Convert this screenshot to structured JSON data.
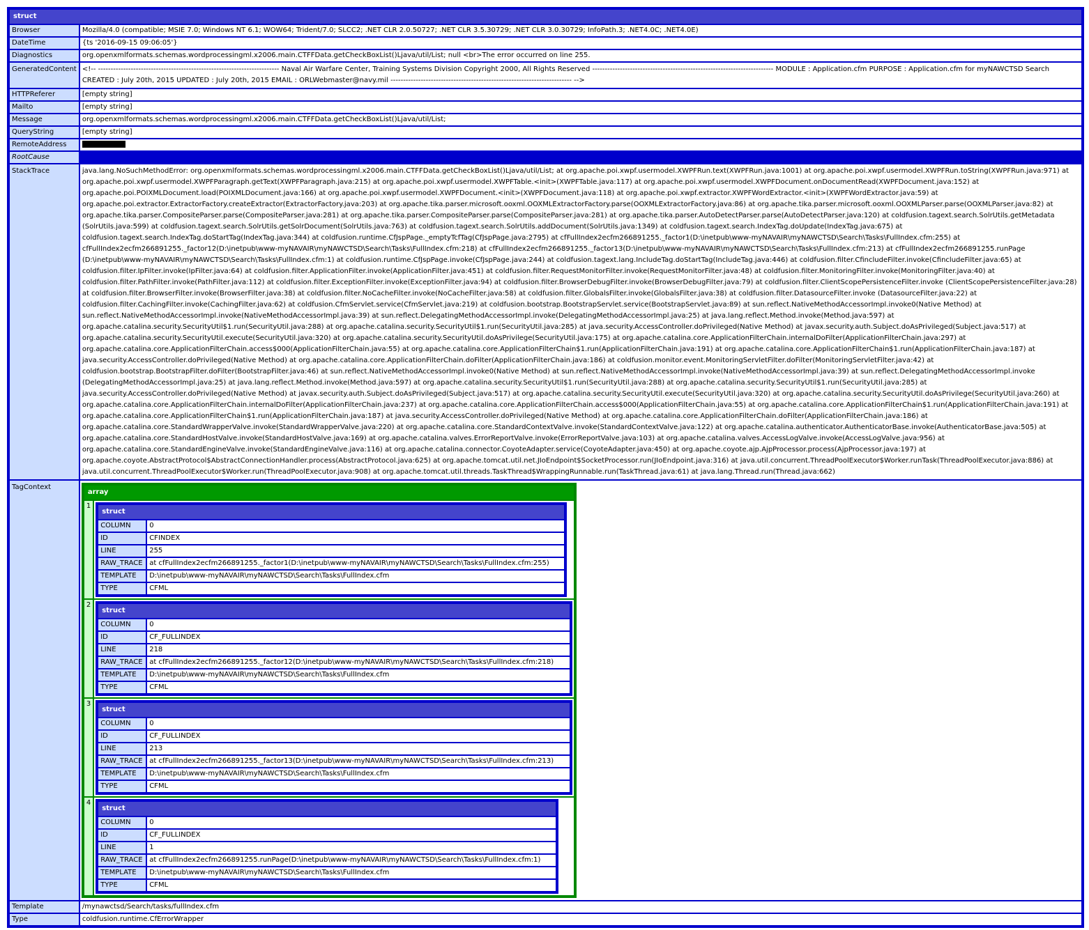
{
  "root": {
    "header": "struct",
    "rows": {
      "browser": {
        "key": "Browser",
        "value": "Mozilla/4.0 (compatible; MSIE 7.0; Windows NT 6.1; WOW64; Trident/7.0; SLCC2; .NET CLR 2.0.50727; .NET CLR 3.5.30729; .NET CLR 3.0.30729; InfoPath.3; .NET4.0C; .NET4.0E)"
      },
      "datetime": {
        "key": "DateTime",
        "value": "{ts '2016-09-15 09:06:05'}"
      },
      "diagnostics": {
        "key": "Diagnostics",
        "value": "org.openxmlformats.schemas.wordprocessingml.x2006.main.CTFFData.getCheckBoxList()Ljava/util/List; null <br>The error occurred on line 255."
      },
      "generated": {
        "key": "GeneratedContent",
        "value": "<!-- ------------------------------------------------------------------------ Naval Air Warfare Center, Training Systems Division Copyright 2000, All Rights Reserved ------------------------------------------------------------------------ MODULE : Application.cfm PURPOSE : Application.cfm for myNAWCTSD Search CREATED : July 20th, 2015 UPDATED : July 20th, 2015 EMAIL : ORLWebmaster@navy.mil ------------------------------------------------------------------------ -->"
      },
      "httpreferer": {
        "key": "HTTPReferer",
        "value": "[empty string]"
      },
      "mailto": {
        "key": "Mailto",
        "value": "[empty string]"
      },
      "message": {
        "key": "Message",
        "value": "org.openxmlformats.schemas.wordprocessingml.x2006.main.CTFFData.getCheckBoxList()Ljava/util/List;"
      },
      "querystring": {
        "key": "QueryString",
        "value": "[empty string]"
      },
      "remoteaddress": {
        "key": "RemoteAddress",
        "value": ""
      },
      "rootcause": {
        "key": "RootCause",
        "value": ""
      },
      "stacktrace": {
        "key": "StackTrace",
        "value": "java.lang.NoSuchMethodError: org.openxmlformats.schemas.wordprocessingml.x2006.main.CTFFData.getCheckBoxList()Ljava/util/List; at org.apache.poi.xwpf.usermodel.XWPFRun.text(XWPFRun.java:1001) at org.apache.poi.xwpf.usermodel.XWPFRun.toString(XWPFRun.java:971) at org.apache.poi.xwpf.usermodel.XWPFParagraph.getText(XWPFParagraph.java:215) at org.apache.poi.xwpf.usermodel.XWPFTable.<init>(XWPFTable.java:117) at org.apache.poi.xwpf.usermodel.XWPFDocument.onDocumentRead(XWPFDocument.java:152) at org.apache.poi.POIXMLDocument.load(POIXMLDocument.java:166) at org.apache.poi.xwpf.usermodel.XWPFDocument.<init>(XWPFDocument.java:118) at org.apache.poi.xwpf.extractor.XWPFWordExtractor.<init>(XWPFWordExtractor.java:59) at org.apache.poi.extractor.ExtractorFactory.createExtractor(ExtractorFactory.java:203) at org.apache.tika.parser.microsoft.ooxml.OOXMLExtractorFactory.parse(OOXMLExtractorFactory.java:86) at org.apache.tika.parser.microsoft.ooxml.OOXMLParser.parse(OOXMLParser.java:82) at org.apache.tika.parser.CompositeParser.parse(CompositeParser.java:281) at org.apache.tika.parser.CompositeParser.parse(CompositeParser.java:281) at org.apache.tika.parser.AutoDetectParser.parse(AutoDetectParser.java:120) at coldfusion.tagext.search.SolrUtils.getMetadata (SolrUtils.java:599) at coldfusion.tagext.search.SolrUtils.getSolrDocument(SolrUtils.java:763) at coldfusion.tagext.search.SolrUtils.addDocument(SolrUtils.java:1349) at coldfusion.tagext.search.IndexTag.doUpdate(IndexTag.java:675) at coldfusion.tagext.search.IndexTag.doStartTag(IndexTag.java:344) at coldfusion.runtime.CfJspPage._emptyTcfTag(CfJspPage.java:2795) at cfFullIndex2ecfm266891255._factor1(D:\\inetpub\\www-myNAVAIR\\myNAWCTSD\\Search\\Tasks\\FullIndex.cfm:255) at cfFullIndex2ecfm266891255._factor12(D:\\inetpub\\www-myNAVAIR\\myNAWCTSD\\Search\\Tasks\\FullIndex.cfm:218) at cfFullIndex2ecfm266891255._factor13(D:\\inetpub\\www-myNAVAIR\\myNAWCTSD\\Search\\Tasks\\FullIndex.cfm:213) at cfFullIndex2ecfm266891255.runPage (D:\\inetpub\\www-myNAVAIR\\myNAWCTSD\\Search\\Tasks\\FullIndex.cfm:1) at coldfusion.runtime.CfJspPage.invoke(CfJspPage.java:244) at coldfusion.tagext.lang.IncludeTag.doStartTag(IncludeTag.java:446) at coldfusion.filter.CfincludeFilter.invoke(CfincludeFilter.java:65) at coldfusion.filter.IpFilter.invoke(IpFilter.java:64) at coldfusion.filter.ApplicationFilter.invoke(ApplicationFilter.java:451) at coldfusion.filter.RequestMonitorFilter.invoke(RequestMonitorFilter.java:48) at coldfusion.filter.MonitoringFilter.invoke(MonitoringFilter.java:40) at coldfusion.filter.PathFilter.invoke(PathFilter.java:112) at coldfusion.filter.ExceptionFilter.invoke(ExceptionFilter.java:94) at coldfusion.filter.BrowserDebugFilter.invoke(BrowserDebugFilter.java:79) at coldfusion.filter.ClientScopePersistenceFilter.invoke (ClientScopePersistenceFilter.java:28) at coldfusion.filter.BrowserFilter.invoke(BrowserFilter.java:38) at coldfusion.filter.NoCacheFilter.invoke(NoCacheFilter.java:58) at coldfusion.filter.GlobalsFilter.invoke(GlobalsFilter.java:38) at coldfusion.filter.DatasourceFilter.invoke (DatasourceFilter.java:22) at coldfusion.filter.CachingFilter.invoke(CachingFilter.java:62) at coldfusion.CfmServlet.service(CfmServlet.java:219) at coldfusion.bootstrap.BootstrapServlet.service(BootstrapServlet.java:89) at sun.reflect.NativeMethodAccessorImpl.invoke0(Native Method) at sun.reflect.NativeMethodAccessorImpl.invoke(NativeMethodAccessorImpl.java:39) at sun.reflect.DelegatingMethodAccessorImpl.invoke(DelegatingMethodAccessorImpl.java:25) at java.lang.reflect.Method.invoke(Method.java:597) at org.apache.catalina.security.SecurityUtil$1.run(SecurityUtil.java:288) at org.apache.catalina.security.SecurityUtil$1.run(SecurityUtil.java:285) at java.security.AccessController.doPrivileged(Native Method) at javax.security.auth.Subject.doAsPrivileged(Subject.java:517) at org.apache.catalina.security.SecurityUtil.execute(SecurityUtil.java:320) at org.apache.catalina.security.SecurityUtil.doAsPrivilege(SecurityUtil.java:175) at org.apache.catalina.core.ApplicationFilterChain.internalDoFilter(ApplicationFilterChain.java:297) at org.apache.catalina.core.ApplicationFilterChain.access$000(ApplicationFilterChain.java:55) at org.apache.catalina.core.ApplicationFilterChain$1.run(ApplicationFilterChain.java:191) at org.apache.catalina.core.ApplicationFilterChain$1.run(ApplicationFilterChain.java:187) at java.security.AccessController.doPrivileged(Native Method) at org.apache.catalina.core.ApplicationFilterChain.doFilter(ApplicationFilterChain.java:186) at coldfusion.monitor.event.MonitoringServletFilter.doFilter(MonitoringServletFilter.java:42) at coldfusion.bootstrap.BootstrapFilter.doFilter(BootstrapFilter.java:46) at sun.reflect.NativeMethodAccessorImpl.invoke0(Native Method) at sun.reflect.NativeMethodAccessorImpl.invoke(NativeMethodAccessorImpl.java:39) at sun.reflect.DelegatingMethodAccessorImpl.invoke (DelegatingMethodAccessorImpl.java:25) at java.lang.reflect.Method.invoke(Method.java:597) at org.apache.catalina.security.SecurityUtil$1.run(SecurityUtil.java:288) at org.apache.catalina.security.SecurityUtil$1.run(SecurityUtil.java:285) at java.security.AccessController.doPrivileged(Native Method) at javax.security.auth.Subject.doAsPrivileged(Subject.java:517) at org.apache.catalina.security.SecurityUtil.execute(SecurityUtil.java:320) at org.apache.catalina.security.SecurityUtil.doAsPrivilege(SecurityUtil.java:260) at org.apache.catalina.core.ApplicationFilterChain.internalDoFilter(ApplicationFilterChain.java:237) at org.apache.catalina.core.ApplicationFilterChain.access$000(ApplicationFilterChain.java:55) at org.apache.catalina.core.ApplicationFilterChain$1.run(ApplicationFilterChain.java:191) at org.apache.catalina.core.ApplicationFilterChain$1.run(ApplicationFilterChain.java:187) at java.security.AccessController.doPrivileged(Native Method) at org.apache.catalina.core.ApplicationFilterChain.doFilter(ApplicationFilterChain.java:186) at org.apache.catalina.core.StandardWrapperValve.invoke(StandardWrapperValve.java:220) at org.apache.catalina.core.StandardContextValve.invoke(StandardContextValve.java:122) at org.apache.catalina.authenticator.AuthenticatorBase.invoke(AuthenticatorBase.java:505) at org.apache.catalina.core.StandardHostValve.invoke(StandardHostValve.java:169) at org.apache.catalina.valves.ErrorReportValve.invoke(ErrorReportValve.java:103) at org.apache.catalina.valves.AccessLogValve.invoke(AccessLogValve.java:956) at org.apache.catalina.core.StandardEngineValve.invoke(StandardEngineValve.java:116) at org.apache.catalina.connector.CoyoteAdapter.service(CoyoteAdapter.java:450) at org.apache.coyote.ajp.AjpProcessor.process(AjpProcessor.java:197) at org.apache.coyote.AbstractProtocol$AbstractConnectionHandler.process(AbstractProtocol.java:625) at org.apache.tomcat.util.net.JIoEndpoint$SocketProcessor.run(JIoEndpoint.java:316) at java.util.concurrent.ThreadPoolExecutor$Worker.runTask(ThreadPoolExecutor.java:886) at java.util.concurrent.ThreadPoolExecutor$Worker.run(ThreadPoolExecutor.java:908) at org.apache.tomcat.util.threads.TaskThread$WrappingRunnable.run(TaskThread.java:61) at java.lang.Thread.run(Thread.java:662)"
      },
      "tagcontext": {
        "key": "TagContext"
      },
      "template": {
        "key": "Template",
        "value": "/mynawctsd/Search/tasks/fullIndex.cfm"
      },
      "type": {
        "key": "Type",
        "value": "coldfusion.runtime.CfErrorWrapper"
      }
    }
  },
  "tagcontext": {
    "array_header": "array",
    "struct_header": "struct",
    "field_labels": {
      "column": "COLUMN",
      "id": "ID",
      "line": "LINE",
      "raw_trace": "RAW_TRACE",
      "template": "TEMPLATE",
      "type": "TYPE"
    },
    "items": [
      {
        "index": "1",
        "column": "0",
        "id": "CFINDEX",
        "line": "255",
        "raw_trace": "at cfFullIndex2ecfm266891255._factor1(D:\\inetpub\\www-myNAVAIR\\myNAWCTSD\\Search\\Tasks\\FullIndex.cfm:255)",
        "template": "D:\\inetpub\\www-myNAVAIR\\myNAWCTSD\\Search\\Tasks\\FullIndex.cfm",
        "type": "CFML"
      },
      {
        "index": "2",
        "column": "0",
        "id": "CF_FULLINDEX",
        "line": "218",
        "raw_trace": "at cfFullIndex2ecfm266891255._factor12(D:\\inetpub\\www-myNAVAIR\\myNAWCTSD\\Search\\Tasks\\FullIndex.cfm:218)",
        "template": "D:\\inetpub\\www-myNAVAIR\\myNAWCTSD\\Search\\Tasks\\FullIndex.cfm",
        "type": "CFML"
      },
      {
        "index": "3",
        "column": "0",
        "id": "CF_FULLINDEX",
        "line": "213",
        "raw_trace": "at cfFullIndex2ecfm266891255._factor13(D:\\inetpub\\www-myNAVAIR\\myNAWCTSD\\Search\\Tasks\\FullIndex.cfm:213)",
        "template": "D:\\inetpub\\www-myNAVAIR\\myNAWCTSD\\Search\\Tasks\\FullIndex.cfm",
        "type": "CFML"
      },
      {
        "index": "4",
        "column": "0",
        "id": "CF_FULLINDEX",
        "line": "1",
        "raw_trace": "at cfFullIndex2ecfm266891255.runPage(D:\\inetpub\\www-myNAVAIR\\myNAWCTSD\\Search\\Tasks\\FullIndex.cfm:1)",
        "template": "D:\\inetpub\\www-myNAVAIR\\myNAWCTSD\\Search\\Tasks\\FullIndex.cfm",
        "type": "CFML"
      }
    ]
  },
  "colors": {
    "struct_border": "#0000cc",
    "struct_header": "#4444cc",
    "struct_key_bg": "#ccddff",
    "array_border": "#008800",
    "array_header": "#009900",
    "array_index_bg": "#ccffcc"
  }
}
